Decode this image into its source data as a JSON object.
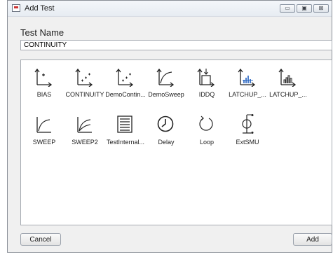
{
  "window": {
    "title": "Add Test"
  },
  "title_buttons": {
    "minimize": "▭",
    "maximize": "▣",
    "close": "⊠"
  },
  "form": {
    "test_name_label": "Test Name",
    "test_name_value": "CONTINUITY"
  },
  "tests": [
    {
      "label": "BIAS",
      "icon": "bias-icon"
    },
    {
      "label": "CONTINUITY",
      "icon": "continuity-icon"
    },
    {
      "label": "DemoContin...",
      "icon": "demo-continuity-icon"
    },
    {
      "label": "DemoSweep",
      "icon": "demo-sweep-icon"
    },
    {
      "label": "IDDQ",
      "icon": "iddq-icon"
    },
    {
      "label": "LATCHUP_...",
      "icon": "latchup-icon"
    },
    {
      "label": "LATCHUP_...",
      "icon": "latchup-pulse-icon"
    },
    {
      "label": "SWEEP",
      "icon": "sweep-icon"
    },
    {
      "label": "SWEEP2",
      "icon": "sweep2-icon"
    },
    {
      "label": "TestInternal...",
      "icon": "test-internal-icon"
    },
    {
      "label": "Delay",
      "icon": "clock-icon"
    },
    {
      "label": "Loop",
      "icon": "loop-icon"
    },
    {
      "label": "ExtSMU",
      "icon": "smu-icon"
    }
  ],
  "buttons": {
    "cancel": "Cancel",
    "add": "Add"
  },
  "colors": {
    "accent": "#1f5fbf",
    "window_bg": "#f0f0f0"
  }
}
